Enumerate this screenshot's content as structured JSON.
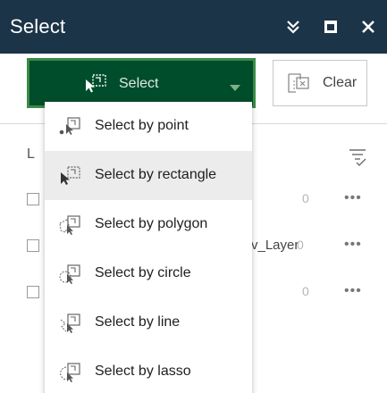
{
  "window": {
    "title": "Select",
    "icons": [
      "collapse-icon",
      "maximize-icon",
      "close-icon"
    ]
  },
  "toolbar": {
    "select_label": "Select",
    "clear_label": "Clear"
  },
  "menu": {
    "items": [
      {
        "label": "Select by point",
        "icon": "select-point-icon",
        "active": false
      },
      {
        "label": "Select by rectangle",
        "icon": "select-rectangle-icon",
        "active": true
      },
      {
        "label": "Select by polygon",
        "icon": "select-polygon-icon",
        "active": false
      },
      {
        "label": "Select by circle",
        "icon": "select-circle-icon",
        "active": false
      },
      {
        "label": "Select by line",
        "icon": "select-line-icon",
        "active": false
      },
      {
        "label": "Select by lasso",
        "icon": "select-lasso-icon",
        "active": false
      }
    ]
  },
  "layers": {
    "header_letter": "L",
    "rows": [
      {
        "name": "",
        "count": "0"
      },
      {
        "name": "v_Layer",
        "count": "0"
      },
      {
        "name": "",
        "count": "0"
      }
    ],
    "more_label": "•••"
  },
  "colors": {
    "titlebar": "#1c3448",
    "select_button": "#004d2b",
    "select_button_border": "#3a8a45",
    "active_item": "#ececec"
  }
}
